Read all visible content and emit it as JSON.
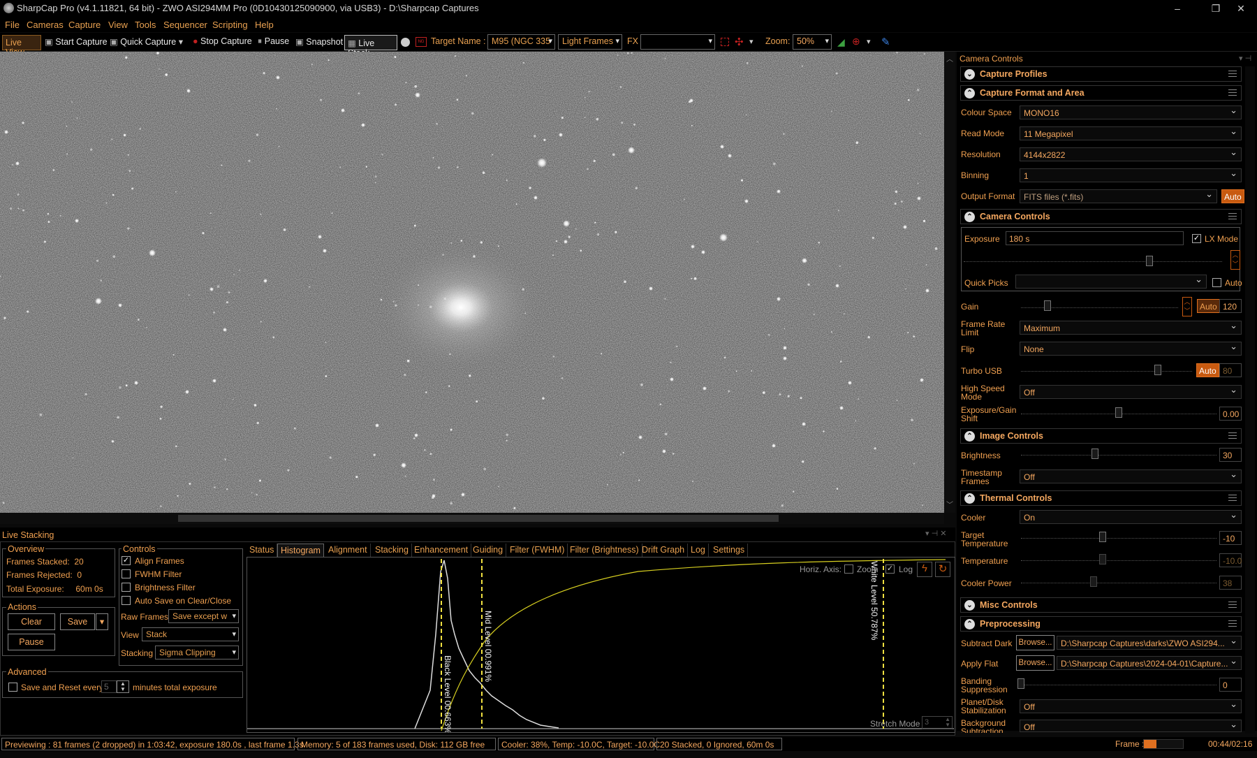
{
  "window": {
    "title": "SharpCap Pro (v4.1.11821, 64 bit) - ZWO ASI294MM Pro (0D10430125090900, via USB3) - D:\\Sharpcap Captures",
    "minimize": "–",
    "maximize": "❐",
    "close": "✕"
  },
  "menu": [
    "File",
    "Cameras",
    "Capture",
    "View",
    "Tools",
    "Sequencer",
    "Scripting",
    "Help"
  ],
  "toolbar": {
    "live_view": "Live View",
    "start_capture": "Start Capture",
    "quick_capture": "Quick Capture",
    "stop_capture": "Stop Capture",
    "pause": "Pause",
    "snapshot": "Snapshot",
    "live_stack": "Live Stack",
    "target_label": "Target Name :",
    "target_value": "M95 (NGC 335",
    "frame_type": "Light Frames",
    "fx_label": "FX",
    "fx_value": "",
    "zoom_label": "Zoom:",
    "zoom_value": "50%"
  },
  "panel": {
    "title": "Camera Controls",
    "capture_profiles": "Capture Profiles",
    "format_area": {
      "title": "Capture Format and Area",
      "colour_space_label": "Colour Space",
      "colour_space": "MONO16",
      "read_mode_label": "Read Mode",
      "read_mode": "11 Megapixel",
      "resolution_label": "Resolution",
      "resolution": "4144x2822",
      "binning_label": "Binning",
      "binning": "1",
      "output_label": "Output Format",
      "output": "FITS files (*.fits)",
      "auto": "Auto"
    },
    "camera_controls": {
      "title": "Camera Controls",
      "exposure_label": "Exposure",
      "exposure": "180 s",
      "lx_mode": "LX Mode",
      "quick_picks_label": "Quick Picks",
      "quick_picks_auto": "Auto",
      "gain_label": "Gain",
      "gain_auto": "Auto",
      "gain": "120",
      "gain_level": 0.17,
      "frl_label": "Frame Rate Limit",
      "frl": "Maximum",
      "flip_label": "Flip",
      "flip": "None",
      "turbo_label": "Turbo USB",
      "turbo_auto": "Auto",
      "turbo": "80",
      "turbo_level": 0.8,
      "hsm_label": "High Speed Mode",
      "hsm": "Off",
      "egs_label": "Exposure/Gain Shift",
      "egs": "0.00",
      "egs_level": 0.5
    },
    "image_controls": {
      "title": "Image Controls",
      "brightness_label": "Brightness",
      "brightness": "30",
      "brightness_level": 0.38,
      "timestamp_label": "Timestamp Frames",
      "timestamp": "Off"
    },
    "thermal": {
      "title": "Thermal Controls",
      "cooler_label": "Cooler",
      "cooler": "On",
      "target_label": "Target Temperature",
      "target": "-10",
      "temp_label": "Temperature",
      "temp": "-10.0",
      "power_label": "Cooler Power",
      "power": "38"
    },
    "misc": "Misc Controls",
    "preproc": {
      "title": "Preprocessing",
      "dark_label": "Subtract Dark",
      "browse": "Browse...",
      "dark": "D:\\Sharpcap Captures\\darks\\ZWO ASI294...",
      "flat_label": "Apply Flat",
      "flat": "D:\\Sharpcap Captures\\2024-04-01\\Capture...",
      "band_label": "Banding Suppression",
      "band": "0",
      "pds_label": "Planet/Disk Stabilization",
      "pds": "Off",
      "bg_label": "Background Subtraction",
      "bg": "Off"
    }
  },
  "live_stacking": {
    "title": "Live Stacking",
    "overview": {
      "title": "Overview",
      "stacked": "Frames Stacked:  20",
      "rejected": "Frames Rejected:  0",
      "exposure": "Total Exposure:     60m 0s"
    },
    "actions": {
      "title": "Actions",
      "clear": "Clear",
      "save": "Save",
      "pause": "Pause"
    },
    "controls": {
      "title": "Controls",
      "align": "Align Frames",
      "fwhm": "FWHM Filter",
      "bright": "Brightness Filter",
      "autosave": "Auto Save on Clear/Close",
      "raw_label": "Raw Frames",
      "raw": "Save except w",
      "view_label": "View",
      "view": "Stack",
      "stacking_label": "Stacking",
      "stacking": "Sigma Clipping"
    },
    "advanced": {
      "title": "Advanced",
      "save_reset": "Save and Reset every",
      "minutes": "5",
      "suffix": "minutes total exposure"
    },
    "tabs": [
      "Status",
      "Histogram",
      "Alignment",
      "Stacking",
      "Enhancement",
      "Guiding",
      "Filter (FWHM)",
      "Filter (Brightness)",
      "Drift Graph",
      "Log",
      "Settings"
    ],
    "histogram": {
      "horiz_axis": "Horiz. Axis:",
      "zoom": "Zoom",
      "log": "Log",
      "black_level": "Black Level 00.663%",
      "mid_level": "Mid Level 00.991%",
      "white_level": "White Level 50.787%",
      "stretch_mode": "Stretch Mode",
      "stretch_value": "3"
    }
  },
  "status": {
    "preview": "Previewing : 81 frames (2 dropped) in 1:03:42, exposure 180.0s , last frame 1.3s",
    "memory": "Memory: 5 of 183 frames used, Disk: 112 GB free",
    "cooler": "Cooler: 38%, Temp: -10.0C, Target: -10.0C",
    "stack": "20 Stacked, 0 Ignored, 60m 0s",
    "frame_label": "Frame :",
    "frame_time": "00:44/02:16",
    "frame_progress": 0.33
  }
}
